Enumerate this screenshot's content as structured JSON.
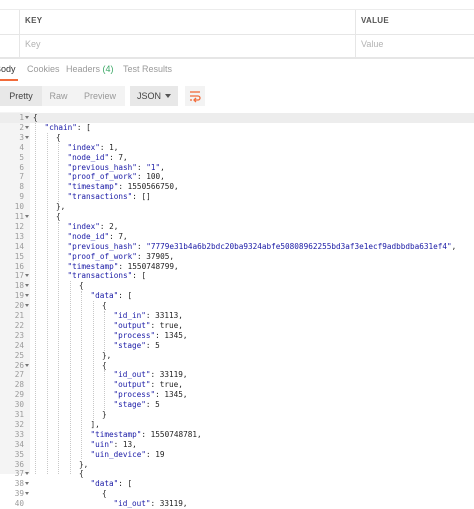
{
  "params": {
    "key_header": "KEY",
    "value_header": "VALUE",
    "key_placeholder": "Key",
    "value_placeholder": "Value"
  },
  "response_tabs": [
    {
      "label": "Body",
      "count": ""
    },
    {
      "label": "Cookies",
      "count": ""
    },
    {
      "label": "Headers",
      "count": "(4)"
    },
    {
      "label": "Test Results",
      "count": ""
    }
  ],
  "toolbar": {
    "pretty_label": "Pretty",
    "raw_label": "Raw",
    "preview_label": "Preview",
    "format_label": "JSON"
  },
  "colors": {
    "accent": "#f26b3a",
    "count_green": "#3ba866",
    "json_key": "#1a1aa6"
  },
  "code_lines": [
    {
      "n": "1",
      "ind": 0,
      "parts": [
        [
          "p",
          "{"
        ]
      ],
      "fold": true
    },
    {
      "n": "2",
      "ind": 1,
      "parts": [
        [
          "k",
          "\"chain\""
        ],
        [
          "p",
          ": ["
        ]
      ],
      "fold": true
    },
    {
      "n": "3",
      "ind": 2,
      "parts": [
        [
          "p",
          "{"
        ]
      ],
      "fold": true
    },
    {
      "n": "4",
      "ind": 3,
      "parts": [
        [
          "k",
          "\"index\""
        ],
        [
          "p",
          ": 1,"
        ]
      ]
    },
    {
      "n": "5",
      "ind": 3,
      "parts": [
        [
          "k",
          "\"node_id\""
        ],
        [
          "p",
          ": 7,"
        ]
      ]
    },
    {
      "n": "6",
      "ind": 3,
      "parts": [
        [
          "k",
          "\"previous_hash\""
        ],
        [
          "p",
          ": "
        ],
        [
          "s",
          "\"1\""
        ],
        [
          "p",
          ","
        ]
      ]
    },
    {
      "n": "7",
      "ind": 3,
      "parts": [
        [
          "k",
          "\"proof_of_work\""
        ],
        [
          "p",
          ": 100,"
        ]
      ]
    },
    {
      "n": "8",
      "ind": 3,
      "parts": [
        [
          "k",
          "\"timestamp\""
        ],
        [
          "p",
          ": 1550566750,"
        ]
      ]
    },
    {
      "n": "9",
      "ind": 3,
      "parts": [
        [
          "k",
          "\"transactions\""
        ],
        [
          "p",
          ": []"
        ]
      ]
    },
    {
      "n": "10",
      "ind": 2,
      "parts": [
        [
          "p",
          "},"
        ]
      ]
    },
    {
      "n": "11",
      "ind": 2,
      "parts": [
        [
          "p",
          "{"
        ]
      ],
      "fold": true
    },
    {
      "n": "12",
      "ind": 3,
      "parts": [
        [
          "k",
          "\"index\""
        ],
        [
          "p",
          ": 2,"
        ]
      ]
    },
    {
      "n": "13",
      "ind": 3,
      "parts": [
        [
          "k",
          "\"node_id\""
        ],
        [
          "p",
          ": 7,"
        ]
      ]
    },
    {
      "n": "14",
      "ind": 3,
      "parts": [
        [
          "k",
          "\"previous_hash\""
        ],
        [
          "p",
          ": "
        ],
        [
          "s",
          "\"7779e31b4a6b2bdc20ba9324abfe50808962255bd3af3e1ecf9adbbdba631ef4\""
        ],
        [
          "p",
          ","
        ]
      ]
    },
    {
      "n": "15",
      "ind": 3,
      "parts": [
        [
          "k",
          "\"proof_of_work\""
        ],
        [
          "p",
          ": 37905,"
        ]
      ]
    },
    {
      "n": "16",
      "ind": 3,
      "parts": [
        [
          "k",
          "\"timestamp\""
        ],
        [
          "p",
          ": 1550748799,"
        ]
      ]
    },
    {
      "n": "17",
      "ind": 3,
      "parts": [
        [
          "k",
          "\"transactions\""
        ],
        [
          "p",
          ": ["
        ]
      ],
      "fold": true
    },
    {
      "n": "18",
      "ind": 4,
      "parts": [
        [
          "p",
          "{"
        ]
      ],
      "fold": true
    },
    {
      "n": "19",
      "ind": 5,
      "parts": [
        [
          "k",
          "\"data\""
        ],
        [
          "p",
          ": ["
        ]
      ],
      "fold": true
    },
    {
      "n": "20",
      "ind": 6,
      "parts": [
        [
          "p",
          "{"
        ]
      ],
      "fold": true
    },
    {
      "n": "21",
      "ind": 7,
      "parts": [
        [
          "k",
          "\"id_in\""
        ],
        [
          "p",
          ": 33113,"
        ]
      ]
    },
    {
      "n": "22",
      "ind": 7,
      "parts": [
        [
          "k",
          "\"output\""
        ],
        [
          "p",
          ": true,"
        ]
      ]
    },
    {
      "n": "23",
      "ind": 7,
      "parts": [
        [
          "k",
          "\"process\""
        ],
        [
          "p",
          ": 1345,"
        ]
      ]
    },
    {
      "n": "24",
      "ind": 7,
      "parts": [
        [
          "k",
          "\"stage\""
        ],
        [
          "p",
          ": 5"
        ]
      ]
    },
    {
      "n": "25",
      "ind": 6,
      "parts": [
        [
          "p",
          "},"
        ]
      ]
    },
    {
      "n": "26",
      "ind": 6,
      "parts": [
        [
          "p",
          "{"
        ]
      ],
      "fold": true
    },
    {
      "n": "27",
      "ind": 7,
      "parts": [
        [
          "k",
          "\"id_out\""
        ],
        [
          "p",
          ": 33119,"
        ]
      ]
    },
    {
      "n": "28",
      "ind": 7,
      "parts": [
        [
          "k",
          "\"output\""
        ],
        [
          "p",
          ": true,"
        ]
      ]
    },
    {
      "n": "29",
      "ind": 7,
      "parts": [
        [
          "k",
          "\"process\""
        ],
        [
          "p",
          ": 1345,"
        ]
      ]
    },
    {
      "n": "30",
      "ind": 7,
      "parts": [
        [
          "k",
          "\"stage\""
        ],
        [
          "p",
          ": 5"
        ]
      ]
    },
    {
      "n": "31",
      "ind": 6,
      "parts": [
        [
          "p",
          "}"
        ]
      ]
    },
    {
      "n": "32",
      "ind": 5,
      "parts": [
        [
          "p",
          "],"
        ]
      ]
    },
    {
      "n": "33",
      "ind": 5,
      "parts": [
        [
          "k",
          "\"timestamp\""
        ],
        [
          "p",
          ": 1550748781,"
        ]
      ]
    },
    {
      "n": "34",
      "ind": 5,
      "parts": [
        [
          "k",
          "\"uin\""
        ],
        [
          "p",
          ": 13,"
        ]
      ]
    },
    {
      "n": "35",
      "ind": 5,
      "parts": [
        [
          "k",
          "\"uin_device\""
        ],
        [
          "p",
          ": 19"
        ]
      ]
    },
    {
      "n": "36",
      "ind": 4,
      "parts": [
        [
          "p",
          "},"
        ]
      ]
    },
    {
      "n": "37",
      "ind": 4,
      "parts": [
        [
          "p",
          "{"
        ]
      ],
      "fold": true
    },
    {
      "n": "38",
      "ind": 5,
      "parts": [
        [
          "k",
          "\"data\""
        ],
        [
          "p",
          ": ["
        ]
      ],
      "fold": true
    },
    {
      "n": "39",
      "ind": 6,
      "parts": [
        [
          "p",
          "{"
        ]
      ],
      "fold": true
    },
    {
      "n": "40",
      "ind": 7,
      "parts": [
        [
          "k",
          "\"id_out\""
        ],
        [
          "p",
          ": 33119,"
        ]
      ]
    }
  ]
}
